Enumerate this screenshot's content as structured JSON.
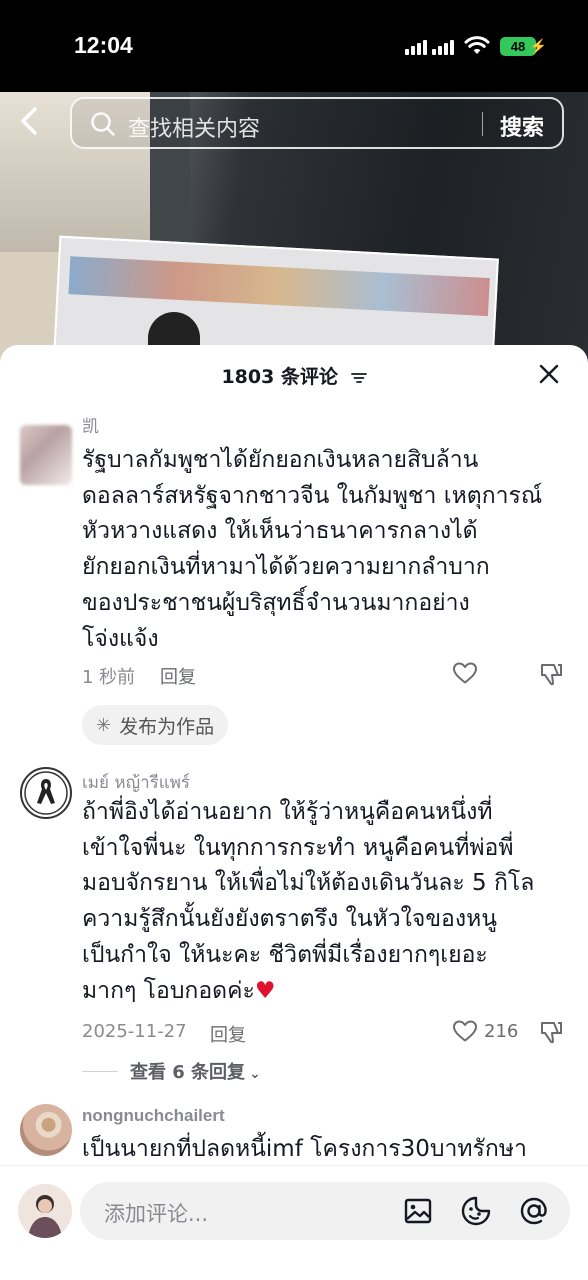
{
  "status_bar": {
    "time": "12:04",
    "battery": "48"
  },
  "search": {
    "placeholder": "查找相关内容",
    "button": "搜索"
  },
  "comments_header": {
    "count_label": "1803 条评论"
  },
  "comments": [
    {
      "username": "凯",
      "text_lines": [
        "รัฐบาลกัมพูชาได้ยักยอกเงินหลายสิบล้าน",
        "ดอลลาร์สหรัฐจากชาวจีน ในกัมพูชา เหตุการณ์",
        "หัวหวางแสดง ให้เห็นว่าธนาคารกลางได้",
        "ยักยอกเงินที่หามาได้ด้วยความยากลำบาก",
        "ของประชาชนผู้บริสุทธิ์จำนวนมากอย่าง",
        "โจ่งแจ้ง"
      ],
      "time": "1 秒前",
      "reply_label": "回复",
      "like_count": "",
      "chip_label": "发布为作品"
    },
    {
      "username": "เมย์ หญ้ารีแพร์",
      "text_lines": [
        "ถ้าพี่อิงได้อ่านอยาก ให้รู้ว่าหนูคือคนหนึ่งที่",
        "เข้าใจพี่นะ ในทุกการกระทำ หนูคือคนที่พ่อพี่",
        "มอบจักรยาน ให้เพื่อไม่ให้ต้องเดินวันละ 5 กิโล",
        "ความรู้สึกนั้นยังยังตราตรึง ในหัวใจของหนู",
        "เป็นกำใจ ให้นะคะ ชีวิตพี่มีเรื่องยากๆเยอะ",
        "มากๆ โอบกอดค่ะ♥"
      ],
      "time": "2025-11-27",
      "reply_label": "回复",
      "like_count": "216",
      "view_replies": "查看 6 条回复"
    },
    {
      "username": "nongnuchchailert",
      "text_lines": [
        "เป็นนายกที่ปลดหนี้imf โครงการ30บาทรักษา"
      ]
    }
  ],
  "input_bar": {
    "placeholder": "添加评论..."
  },
  "colors": {
    "heart": "#e0132f",
    "battery": "#34c759",
    "text": "#161823",
    "muted": "#8a8b91"
  }
}
